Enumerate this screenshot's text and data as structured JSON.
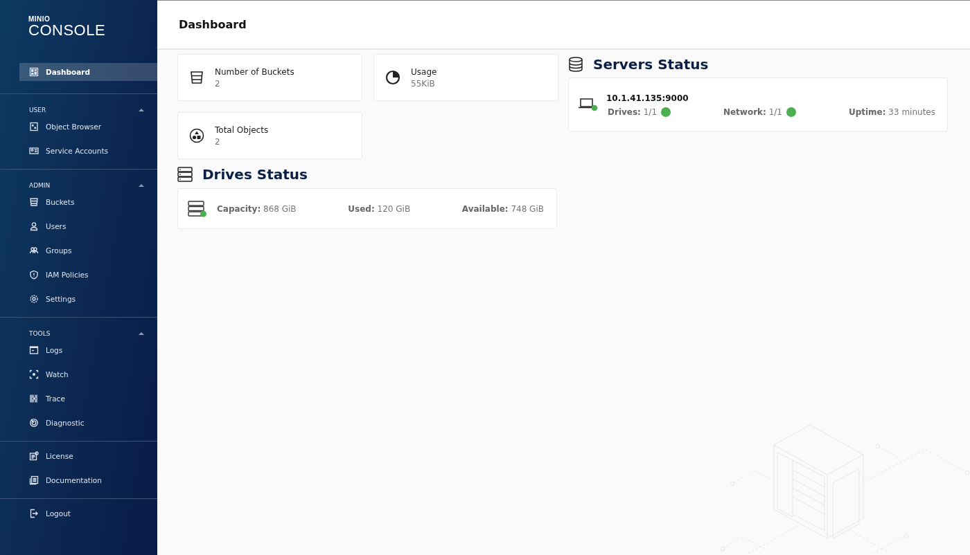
{
  "logo": {
    "brand": "MINIO",
    "product": "CONSOLE"
  },
  "sidebar": {
    "sections": [
      {
        "items": [
          {
            "label": "Dashboard",
            "selected": true
          }
        ]
      },
      {
        "heading": "USER",
        "expanded": true,
        "items": [
          {
            "label": "Object Browser",
            "selected": false
          },
          {
            "label": "Service Accounts",
            "selected": false
          }
        ]
      },
      {
        "heading": "ADMIN",
        "expanded": true,
        "items": [
          {
            "label": "Buckets",
            "selected": false
          },
          {
            "label": "Users",
            "selected": false
          },
          {
            "label": "Groups",
            "selected": false
          },
          {
            "label": "IAM Policies",
            "selected": false
          },
          {
            "label": "Settings",
            "selected": false
          }
        ]
      },
      {
        "heading": "TOOLS",
        "expanded": true,
        "items": [
          {
            "label": "Logs",
            "selected": false
          },
          {
            "label": "Watch",
            "selected": false
          },
          {
            "label": "Trace",
            "selected": false
          },
          {
            "label": "Diagnostic",
            "selected": false
          }
        ]
      },
      {
        "items": [
          {
            "label": "License",
            "selected": false
          },
          {
            "label": "Documentation",
            "selected": false
          }
        ]
      },
      {
        "items": [
          {
            "label": "Logout",
            "selected": false
          }
        ]
      }
    ]
  },
  "page_title": "Dashboard",
  "stats": [
    {
      "label": "Number of Buckets",
      "value": "2"
    },
    {
      "label": "Usage",
      "value": "55KiB"
    },
    {
      "label": "Total Objects",
      "value": "2"
    }
  ],
  "drives_status": {
    "title": "Drives Status",
    "healthy": true,
    "fields": [
      {
        "label": "Capacity:",
        "value": "868 GiB"
      },
      {
        "label": "Used:",
        "value": "120 GiB"
      },
      {
        "label": "Available:",
        "value": "748 GiB"
      }
    ]
  },
  "servers_status": {
    "title": "Servers Status",
    "servers": [
      {
        "address": "10.1.41.135:9000",
        "online": true,
        "fields": [
          {
            "label": "Drives:",
            "value": "1/1",
            "ok": true
          },
          {
            "label": "Network:",
            "value": "1/1",
            "ok": true
          },
          {
            "label": "Uptime:",
            "value": "33 minutes"
          }
        ]
      }
    ]
  }
}
